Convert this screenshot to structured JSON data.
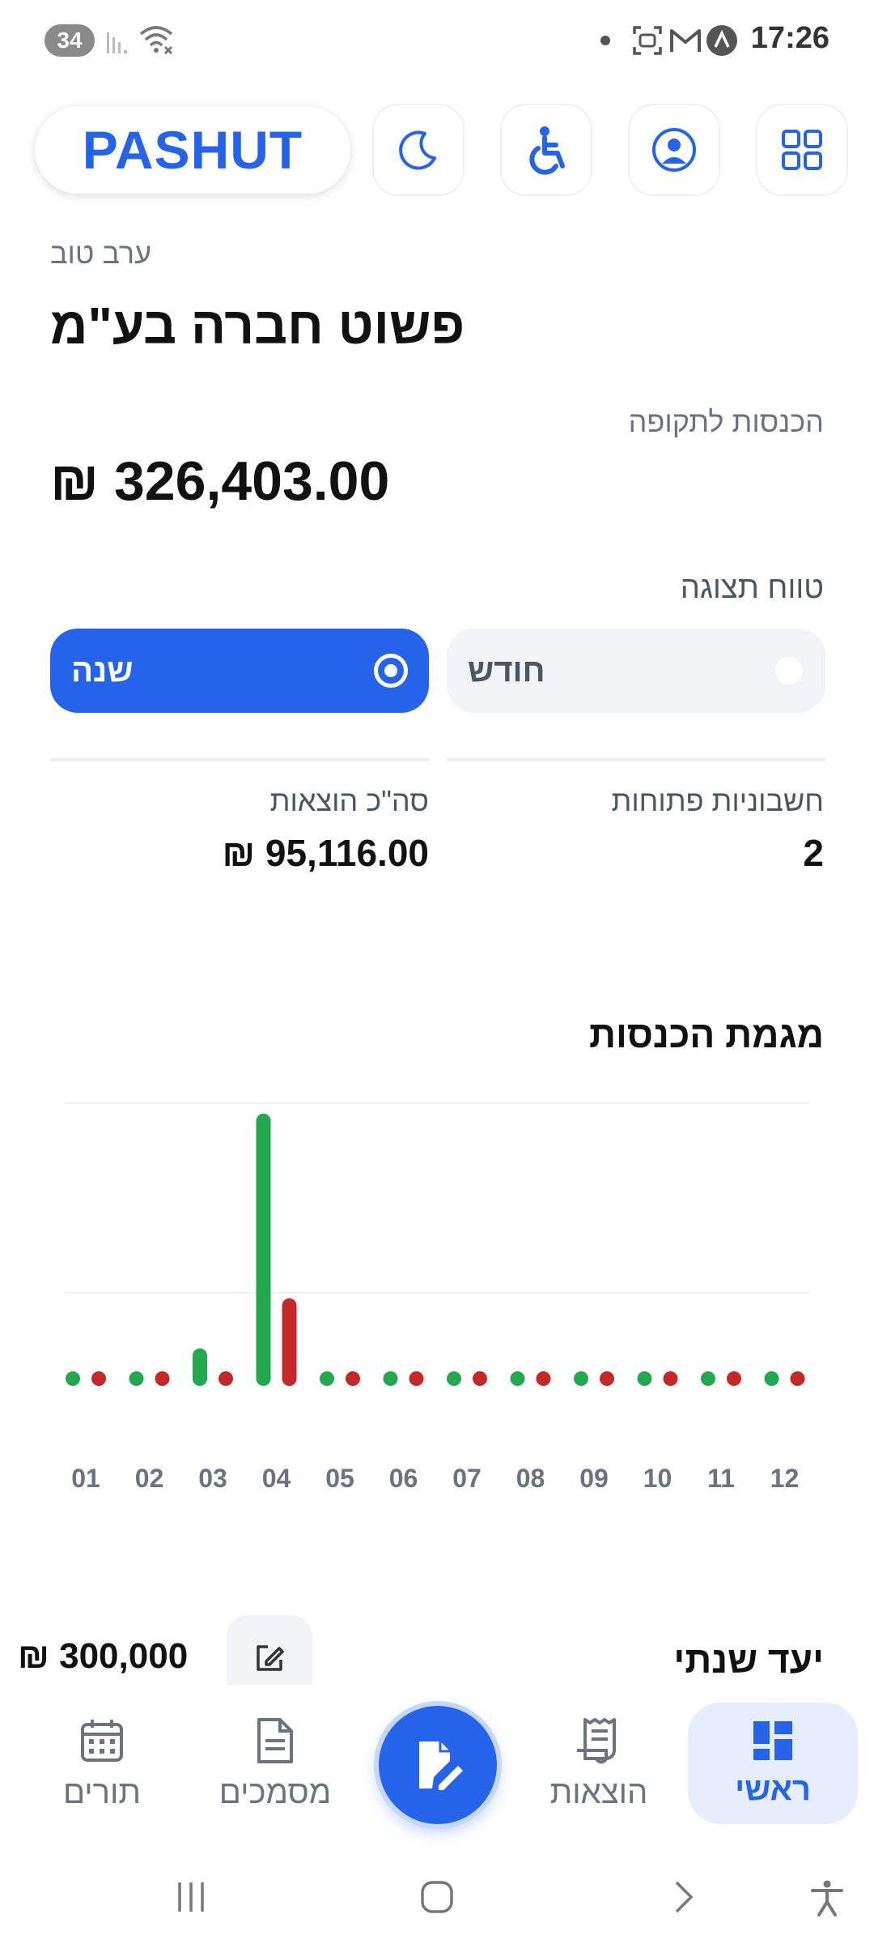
{
  "status_bar": {
    "notification_count": "34",
    "time": "17:26",
    "icons": [
      "signal-icon",
      "wifi-icon",
      "dot-icon",
      "screenshot-icon",
      "gmail-icon",
      "app-icon"
    ]
  },
  "header": {
    "logo": "PASHUT",
    "buttons": [
      "grid-icon",
      "profile-icon",
      "accessibility-icon",
      "dark-mode-icon"
    ]
  },
  "greeting": "ערב טוב",
  "company_name": "פשוט חברה בע\"מ",
  "income": {
    "label": "הכנסות לתקופה",
    "amount": "₪ 326,403.00"
  },
  "range": {
    "label": "טווח תצוגה",
    "options": [
      {
        "label": "חודש",
        "selected": false
      },
      {
        "label": "שנה",
        "selected": true
      }
    ]
  },
  "stats": {
    "open_invoices_label": "חשבוניות פתוחות",
    "open_invoices_value": "2",
    "total_expenses_label": "סה\"כ הוצאות",
    "total_expenses_value": "₪ 95,116.00"
  },
  "chart_title": "מגמת הכנסות",
  "chart_data": {
    "type": "bar",
    "categories": [
      "01",
      "02",
      "03",
      "04",
      "05",
      "06",
      "07",
      "08",
      "09",
      "10",
      "11",
      "12"
    ],
    "series": [
      {
        "color": "#22a94f",
        "values": [
          0,
          0,
          45000,
          326403,
          0,
          0,
          0,
          0,
          0,
          0,
          0,
          0
        ]
      },
      {
        "color": "#c62828",
        "values": [
          0,
          0,
          12000,
          105000,
          0,
          0,
          0,
          0,
          0,
          0,
          0,
          0
        ]
      }
    ],
    "ylim": [
      0,
      330000
    ],
    "grid": true
  },
  "goal": {
    "label": "יעד שנתי",
    "value": "₪ 300,000"
  },
  "bottom_nav": {
    "home": "ראשי",
    "expenses": "הוצאות",
    "documents": "מסמכים",
    "appointments": "תורים"
  },
  "colors": {
    "primary": "#2563eb",
    "income": "#22a94f",
    "expense": "#c62828"
  }
}
